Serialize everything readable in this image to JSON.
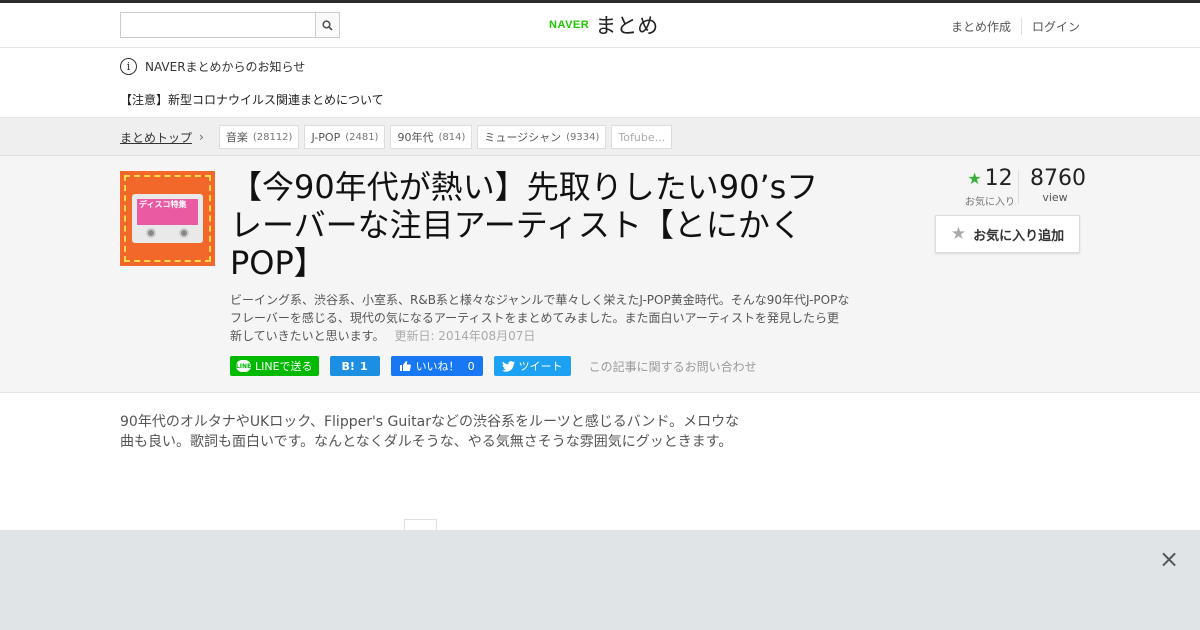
{
  "search": {
    "placeholder": ""
  },
  "logo": {
    "brand": "NAVER",
    "product": "まとめ"
  },
  "header": {
    "create": "まとめ作成",
    "login": "ログイン"
  },
  "notice": {
    "heading": "NAVERまとめからのお知らせ",
    "link": "【注意】新型コロナウイルス関連まとめについて"
  },
  "breadcrumb": {
    "top": "まとめトップ",
    "tags": [
      {
        "label": "音楽",
        "count": "(28112)"
      },
      {
        "label": "J-POP",
        "count": "(2481)"
      },
      {
        "label": "90年代",
        "count": "(814)"
      },
      {
        "label": "ミュージシャン",
        "count": "(9334)"
      },
      {
        "label": "Tofube...",
        "count": ""
      }
    ]
  },
  "article": {
    "thumb_text": "ディスコ特集",
    "title": "【今90年代が熱い】先取りしたい90’sフレーバーな注目アーティスト【とにかくPOP】",
    "description": "ビーイング系、渋谷系、小室系、R&B系と様々なジャンルで華々しく栄えたJ-POP黄金時代。そんな90年代J-POPなフレーバーを感じる、現代の気になるアーティストをまとめてみました。また面白いアーティストを発見したら更新していきたいと思います。",
    "updated": "更新日: 2014年08月07日"
  },
  "share": {
    "line": "LINEで送る",
    "line_icon": "LINE",
    "hatena_icon": "B!",
    "hatena_count": "1",
    "fb_label": "いいね！",
    "fb_count": "0",
    "tweet": "ツイート",
    "contact": "この記事に関するお問い合わせ"
  },
  "stats": {
    "fav_count": "12",
    "fav_label": "お気に入り",
    "view_count": "8760",
    "view_label": "view",
    "fav_button": "お気に入り追加"
  },
  "body": {
    "text": "90年代のオルタナやUKロック、Flipper's Guitarなどの渋谷系をルーツと感じるバンド。メロウな曲も良い。歌詞も面白いです。なんとなくダルそうな、やる気無さそうな雰囲気にグッときます。"
  },
  "ad": {
    "close": "×"
  },
  "colors": {
    "naver_green": "#1ec800",
    "line_green": "#00b900",
    "fb_blue": "#1877f2",
    "tw_blue": "#1da1f2",
    "star_green": "#38b03b"
  }
}
